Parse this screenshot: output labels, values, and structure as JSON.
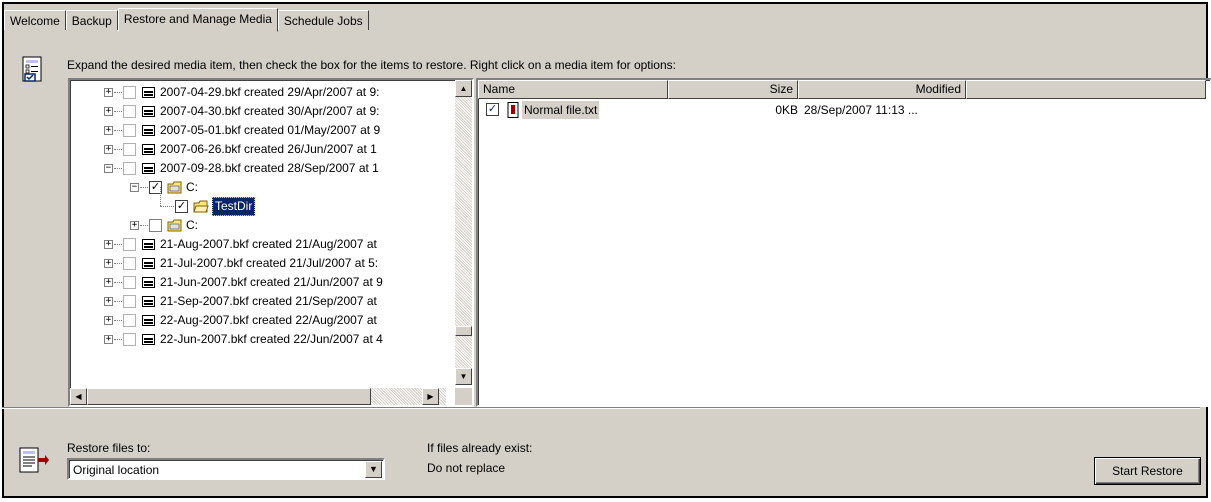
{
  "tabs": [
    {
      "label": "Welcome",
      "active": false
    },
    {
      "label": "Backup",
      "active": false
    },
    {
      "label": "Restore and Manage Media",
      "active": true
    },
    {
      "label": "Schedule Jobs",
      "active": false
    }
  ],
  "instruction": "Expand the desired media item, then check the box for the items to restore. Right click on a media item for options:",
  "tree": {
    "items": [
      {
        "label": "2007-04-29.bkf created 29/Apr/2007 at 9:",
        "expander": "+",
        "checked": false,
        "icon": "tape-media-icon"
      },
      {
        "label": "2007-04-30.bkf created 30/Apr/2007 at 9:",
        "expander": "+",
        "checked": false,
        "icon": "tape-media-icon"
      },
      {
        "label": "2007-05-01.bkf created 01/May/2007 at 9",
        "expander": "+",
        "checked": false,
        "icon": "tape-media-icon"
      },
      {
        "label": "2007-06-26.bkf created 26/Jun/2007 at 1",
        "expander": "+",
        "checked": false,
        "icon": "tape-media-icon"
      },
      {
        "label": "2007-09-28.bkf created 28/Sep/2007 at 1",
        "expander": "-",
        "checked": false,
        "icon": "tape-media-icon"
      },
      {
        "label": "C:",
        "expander": "-",
        "checked": true,
        "icon": "drive-icon"
      },
      {
        "label": "TestDir",
        "expander": "",
        "checked": true,
        "icon": "folder-icon",
        "selected": true
      },
      {
        "label": "C:",
        "expander": "+",
        "checked": false,
        "icon": "drive-icon"
      },
      {
        "label": "21-Aug-2007.bkf created 21/Aug/2007 at",
        "expander": "+",
        "checked": false,
        "icon": "tape-media-icon"
      },
      {
        "label": "21-Jul-2007.bkf created 21/Jul/2007 at 5:",
        "expander": "+",
        "checked": false,
        "icon": "tape-media-icon"
      },
      {
        "label": "21-Jun-2007.bkf created 21/Jun/2007 at 9",
        "expander": "+",
        "checked": false,
        "icon": "tape-media-icon"
      },
      {
        "label": "21-Sep-2007.bkf created 21/Sep/2007 at",
        "expander": "+",
        "checked": false,
        "icon": "tape-media-icon"
      },
      {
        "label": "22-Aug-2007.bkf created 22/Aug/2007 at",
        "expander": "+",
        "checked": false,
        "icon": "tape-media-icon"
      },
      {
        "label": "22-Jun-2007.bkf created 22/Jun/2007 at 4",
        "expander": "+",
        "checked": false,
        "icon": "tape-media-icon"
      }
    ]
  },
  "file_list": {
    "columns": [
      "Name",
      "Size",
      "Modified"
    ],
    "rows": [
      {
        "name": "Normal file.txt",
        "size": "0KB",
        "modified": "28/Sep/2007 11:13 ...",
        "checked": true
      }
    ]
  },
  "restore_to": {
    "label": "Restore files to:",
    "value": "Original location"
  },
  "if_exists": {
    "label": "If files already exist:",
    "value": "Do not replace"
  },
  "start_button": "Start Restore"
}
